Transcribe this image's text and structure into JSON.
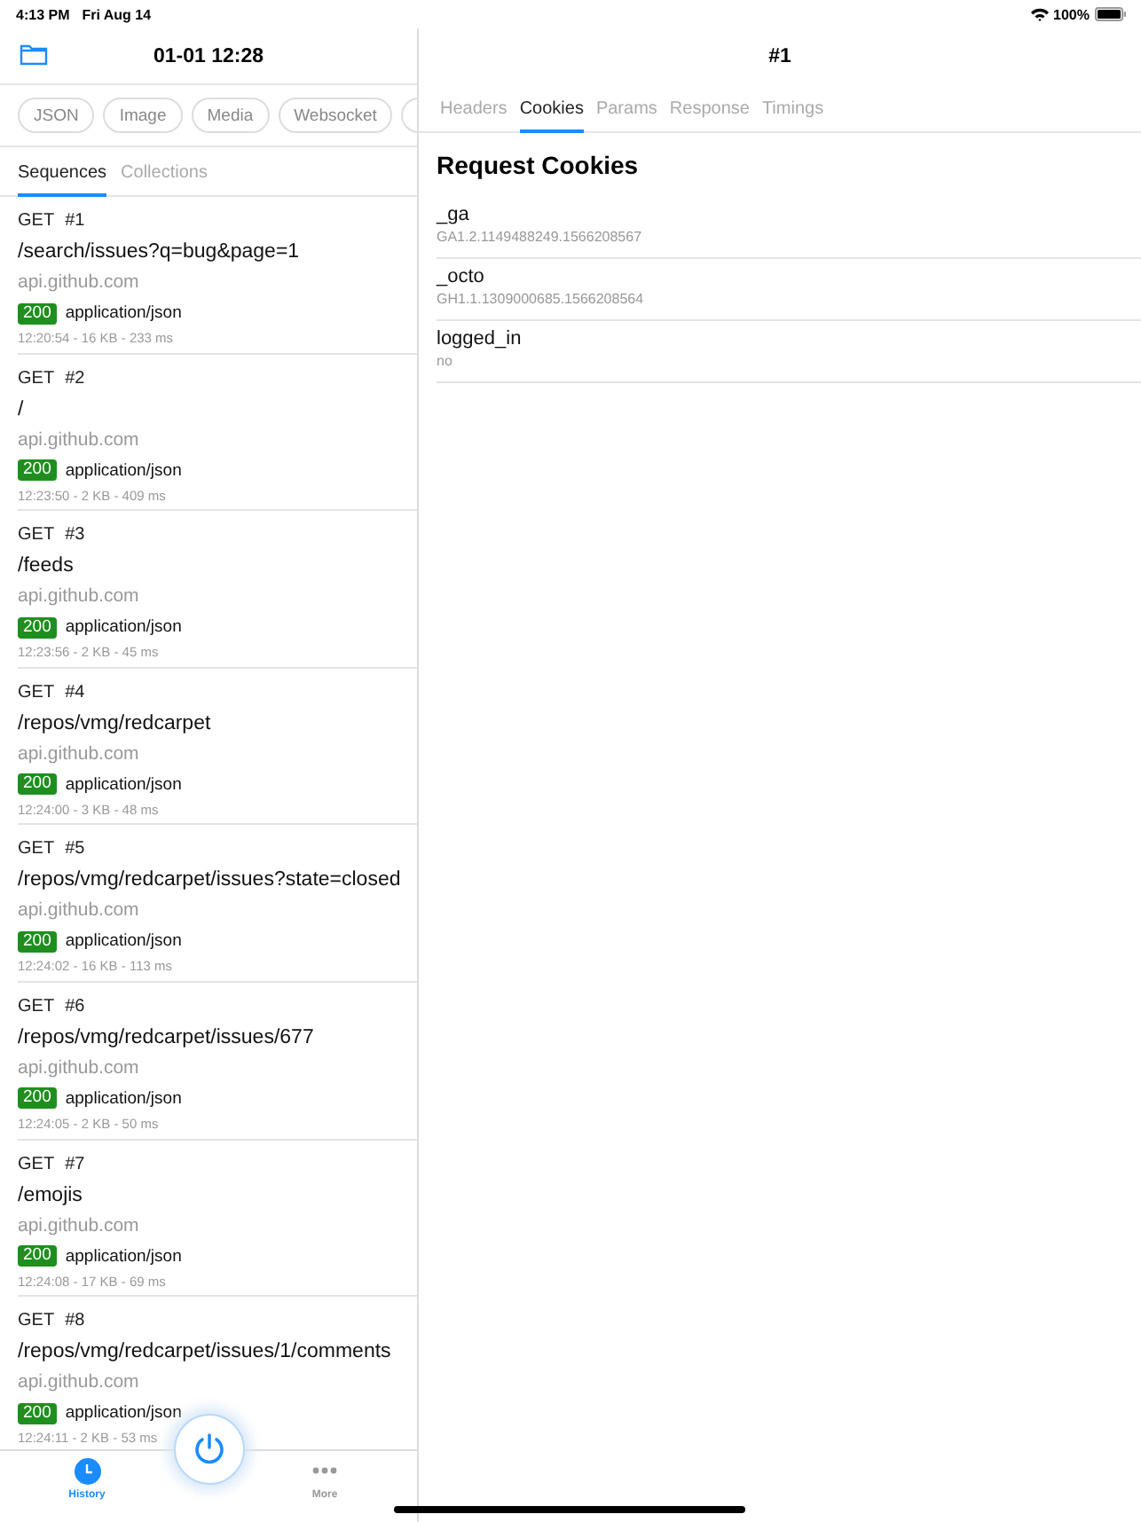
{
  "status_bar": {
    "time": "4:13 PM",
    "date": "Fri Aug 14",
    "battery": "100%"
  },
  "sidebar": {
    "title": "01-01 12:28",
    "filters": [
      {
        "label": "JSON"
      },
      {
        "label": "Image"
      },
      {
        "label": "Media"
      },
      {
        "label": "Websocket"
      }
    ],
    "tabs": [
      {
        "label": "Sequences",
        "selected": true
      },
      {
        "label": "Collections",
        "selected": false
      }
    ],
    "requests": [
      {
        "method": "GET",
        "number": "#1",
        "path": "/search/issues?q=bug&page=1",
        "host": "api.github.com",
        "status": "200",
        "content_type": "application/json",
        "meta": "12:20:54 - 16 KB - 233 ms"
      },
      {
        "method": "GET",
        "number": "#2",
        "path": "/",
        "host": "api.github.com",
        "status": "200",
        "content_type": "application/json",
        "meta": "12:23:50 - 2 KB - 409 ms"
      },
      {
        "method": "GET",
        "number": "#3",
        "path": "/feeds",
        "host": "api.github.com",
        "status": "200",
        "content_type": "application/json",
        "meta": "12:23:56 - 2 KB - 45 ms"
      },
      {
        "method": "GET",
        "number": "#4",
        "path": "/repos/vmg/redcarpet",
        "host": "api.github.com",
        "status": "200",
        "content_type": "application/json",
        "meta": "12:24:00 - 3 KB - 48 ms"
      },
      {
        "method": "GET",
        "number": "#5",
        "path": "/repos/vmg/redcarpet/issues?state=closed",
        "host": "api.github.com",
        "status": "200",
        "content_type": "application/json",
        "meta": "12:24:02 - 16 KB - 113 ms"
      },
      {
        "method": "GET",
        "number": "#6",
        "path": "/repos/vmg/redcarpet/issues/677",
        "host": "api.github.com",
        "status": "200",
        "content_type": "application/json",
        "meta": "12:24:05 - 2 KB - 50 ms"
      },
      {
        "method": "GET",
        "number": "#7",
        "path": "/emojis",
        "host": "api.github.com",
        "status": "200",
        "content_type": "application/json",
        "meta": "12:24:08 - 17 KB - 69 ms"
      },
      {
        "method": "GET",
        "number": "#8",
        "path": "/repos/vmg/redcarpet/issues/1/comments",
        "host": "api.github.com",
        "status": "200",
        "content_type": "application/json",
        "meta": "12:24:11 - 2 KB - 53 ms"
      }
    ],
    "tab_bar": [
      {
        "label": "History",
        "kind": "history",
        "selected": true
      },
      {
        "label": "More",
        "kind": "more",
        "selected": false
      }
    ]
  },
  "detail": {
    "title": "#1",
    "tabs": [
      {
        "label": "Headers",
        "selected": false
      },
      {
        "label": "Cookies",
        "selected": true
      },
      {
        "label": "Params",
        "selected": false
      },
      {
        "label": "Response",
        "selected": false
      },
      {
        "label": "Timings",
        "selected": false
      }
    ],
    "section_title": "Request Cookies",
    "cookies": [
      {
        "name": "_ga",
        "value": "GA1.2.1149488249.1566208567"
      },
      {
        "name": "_octo",
        "value": "GH1.1.1309000685.1566208564"
      },
      {
        "name": "logged_in",
        "value": "no"
      }
    ]
  }
}
